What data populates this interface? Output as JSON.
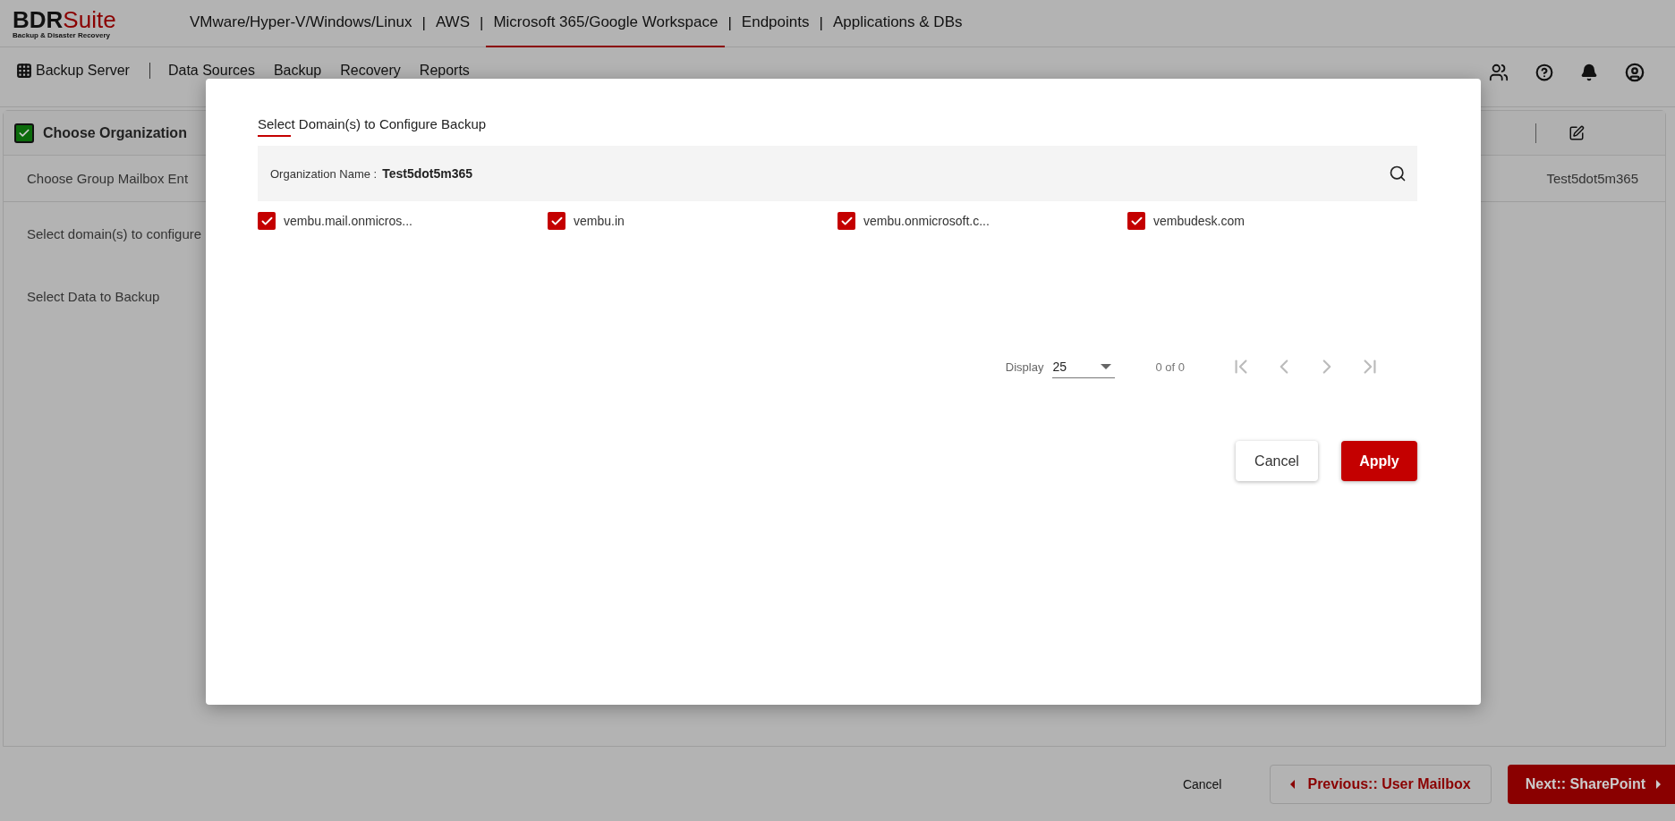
{
  "brand": {
    "name": "BDR",
    "name_accent": "Suite",
    "tagline": "Backup & Disaster Recovery"
  },
  "product_tabs": [
    {
      "label": "VMware/Hyper-V/Windows/Linux",
      "selected": false
    },
    {
      "label": "AWS",
      "selected": false
    },
    {
      "label": "Microsoft 365/Google Workspace",
      "selected": true
    },
    {
      "label": "Endpoints",
      "selected": false
    },
    {
      "label": "Applications & DBs",
      "selected": false
    }
  ],
  "tab_separators": [
    "|",
    "|",
    "|",
    "|"
  ],
  "nav": {
    "server": "Backup Server",
    "items": [
      "Data Sources",
      "Backup",
      "Recovery",
      "Reports"
    ]
  },
  "wizard": {
    "header": {
      "label": "Choose Organization",
      "checked": true
    },
    "rows": [
      {
        "label": "Choose Group Mailbox Ent",
        "value": "Test5dot5m365"
      },
      {
        "label": "Select domain(s) to configure"
      },
      {
        "label": "Select Data to Backup"
      }
    ]
  },
  "footer": {
    "cancel": "Cancel",
    "previous": "Previous:: User Mailbox",
    "next": "Next:: SharePoint"
  },
  "dialog": {
    "title": "Select Domain(s) to Configure Backup",
    "org_label": "Organization Name :",
    "org_value": "Test5dot5m365",
    "domains": [
      {
        "name": "vembu.mail.onmicros...",
        "checked": true
      },
      {
        "name": "vembu.in",
        "checked": true
      },
      {
        "name": "vembu.onmicrosoft.c...",
        "checked": true
      },
      {
        "name": "vembudesk.com",
        "checked": true
      }
    ],
    "pagination": {
      "display_label": "Display",
      "page_size": "25",
      "count": "0 of 0"
    },
    "buttons": {
      "cancel": "Cancel",
      "apply": "Apply"
    }
  }
}
